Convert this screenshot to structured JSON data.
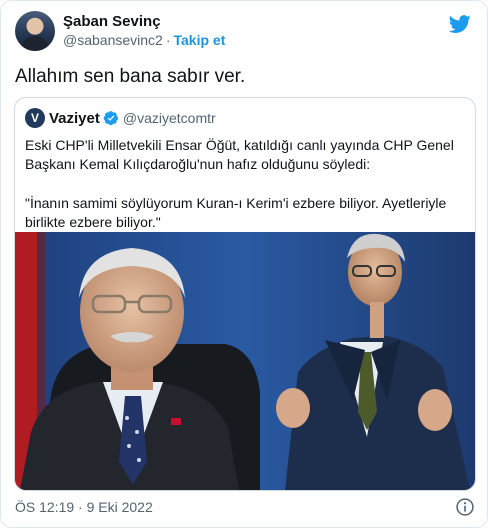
{
  "author": {
    "name": "Şaban Sevinç",
    "handle": "@sabansevinc2",
    "separator": "·",
    "follow_label": "Takip et"
  },
  "tweet": {
    "text": "Allahım sen bana sabır ver.",
    "timestamp": "ÖS 12:19 · 9 Eki 2022"
  },
  "quoted_tweet": {
    "logo_letter": "V",
    "name": "Vaziyet",
    "handle": "@vaziyetcomtr",
    "paragraph_1": "Eski CHP'li Milletvekili Ensar Öğüt, katıldığı canlı yayında CHP Genel Başkanı Kemal Kılıçdaroğlu'nun hafız olduğunu söyledi:",
    "paragraph_2": "\"İnanın samimi söylüyorum Kuran-ı Kerim'i ezbere biliyor. Ayetleriyle birlikte ezbere biliyor.\""
  },
  "icons": {
    "bird": "twitter-bird-icon",
    "verified": "verified-badge-icon",
    "info": "info-icon"
  },
  "colors": {
    "twitter_blue": "#1d9bf0",
    "follow_blue": "#1b95e0",
    "secondary_text": "#536471",
    "border": "#cfd9de"
  }
}
